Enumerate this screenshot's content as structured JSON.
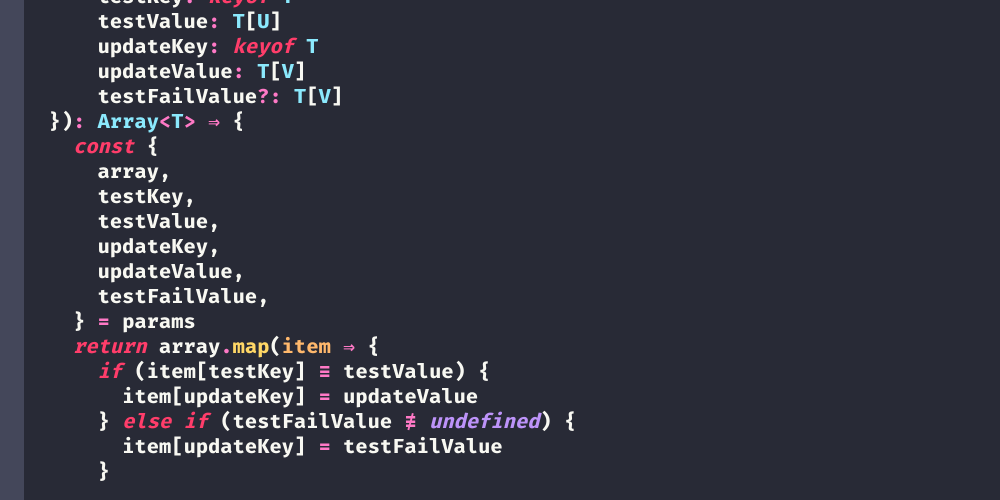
{
  "code": {
    "lines": [
      {
        "indent": 2,
        "tokens": [
          {
            "t": "testKey",
            "c": "ident"
          },
          {
            "t": ": ",
            "c": "op"
          },
          {
            "t": "keyof ",
            "c": "kw"
          },
          {
            "t": "T",
            "c": "type"
          }
        ]
      },
      {
        "indent": 2,
        "tokens": [
          {
            "t": "testValue",
            "c": "ident"
          },
          {
            "t": ": ",
            "c": "op"
          },
          {
            "t": "T",
            "c": "type"
          },
          {
            "t": "[",
            "c": "br"
          },
          {
            "t": "U",
            "c": "type"
          },
          {
            "t": "]",
            "c": "br"
          }
        ]
      },
      {
        "indent": 2,
        "tokens": [
          {
            "t": "updateKey",
            "c": "ident"
          },
          {
            "t": ": ",
            "c": "op"
          },
          {
            "t": "keyof ",
            "c": "kw"
          },
          {
            "t": "T",
            "c": "type"
          }
        ]
      },
      {
        "indent": 2,
        "tokens": [
          {
            "t": "updateValue",
            "c": "ident"
          },
          {
            "t": ": ",
            "c": "op"
          },
          {
            "t": "T",
            "c": "type"
          },
          {
            "t": "[",
            "c": "br"
          },
          {
            "t": "V",
            "c": "type"
          },
          {
            "t": "]",
            "c": "br"
          }
        ]
      },
      {
        "indent": 2,
        "tokens": [
          {
            "t": "testFailValue",
            "c": "ident"
          },
          {
            "t": "?: ",
            "c": "op"
          },
          {
            "t": "T",
            "c": "type"
          },
          {
            "t": "[",
            "c": "br"
          },
          {
            "t": "V",
            "c": "type"
          },
          {
            "t": "]",
            "c": "br"
          }
        ]
      },
      {
        "indent": 0,
        "tokens": [
          {
            "t": "}",
            "c": "br"
          },
          {
            "t": ")",
            "c": "br"
          },
          {
            "t": ": ",
            "c": "op"
          },
          {
            "t": "Array",
            "c": "type"
          },
          {
            "t": "<",
            "c": "op"
          },
          {
            "t": "T",
            "c": "type"
          },
          {
            "t": ">",
            "c": "op"
          },
          {
            "t": " ",
            "c": "fg"
          },
          {
            "t": "⇒",
            "c": "op"
          },
          {
            "t": " ",
            "c": "fg"
          },
          {
            "t": "{",
            "c": "br"
          }
        ]
      },
      {
        "indent": 1,
        "tokens": [
          {
            "t": "const ",
            "c": "kw"
          },
          {
            "t": "{",
            "c": "br"
          }
        ]
      },
      {
        "indent": 2,
        "tokens": [
          {
            "t": "array",
            "c": "ident"
          },
          {
            "t": ",",
            "c": "punc"
          }
        ]
      },
      {
        "indent": 2,
        "tokens": [
          {
            "t": "testKey",
            "c": "ident"
          },
          {
            "t": ",",
            "c": "punc"
          }
        ]
      },
      {
        "indent": 2,
        "tokens": [
          {
            "t": "testValue",
            "c": "ident"
          },
          {
            "t": ",",
            "c": "punc"
          }
        ]
      },
      {
        "indent": 2,
        "tokens": [
          {
            "t": "updateKey",
            "c": "ident"
          },
          {
            "t": ",",
            "c": "punc"
          }
        ]
      },
      {
        "indent": 2,
        "tokens": [
          {
            "t": "updateValue",
            "c": "ident"
          },
          {
            "t": ",",
            "c": "punc"
          }
        ]
      },
      {
        "indent": 2,
        "tokens": [
          {
            "t": "testFailValue",
            "c": "ident"
          },
          {
            "t": ",",
            "c": "punc"
          }
        ]
      },
      {
        "indent": 1,
        "tokens": [
          {
            "t": "} ",
            "c": "br"
          },
          {
            "t": "=",
            "c": "op"
          },
          {
            "t": " params",
            "c": "ident"
          }
        ]
      },
      {
        "indent": 1,
        "tokens": [
          {
            "t": "return ",
            "c": "kw"
          },
          {
            "t": "array",
            "c": "ident"
          },
          {
            "t": ".",
            "c": "op"
          },
          {
            "t": "map",
            "c": "fn"
          },
          {
            "t": "(",
            "c": "br"
          },
          {
            "t": "item ",
            "c": "param"
          },
          {
            "t": "⇒",
            "c": "op"
          },
          {
            "t": " ",
            "c": "fg"
          },
          {
            "t": "{",
            "c": "br"
          }
        ]
      },
      {
        "indent": 2,
        "tokens": [
          {
            "t": "if ",
            "c": "kw"
          },
          {
            "t": "(",
            "c": "br"
          },
          {
            "t": "item",
            "c": "ident"
          },
          {
            "t": "[",
            "c": "br"
          },
          {
            "t": "testKey",
            "c": "ident"
          },
          {
            "t": "]",
            "c": "br"
          },
          {
            "t": " ",
            "c": "fg"
          },
          {
            "t": "≡",
            "c": "op"
          },
          {
            "t": " ",
            "c": "fg"
          },
          {
            "t": "testValue",
            "c": "ident"
          },
          {
            "t": ")",
            "c": "br"
          },
          {
            "t": " ",
            "c": "fg"
          },
          {
            "t": "{",
            "c": "br"
          }
        ]
      },
      {
        "indent": 3,
        "tokens": [
          {
            "t": "item",
            "c": "ident"
          },
          {
            "t": "[",
            "c": "br"
          },
          {
            "t": "updateKey",
            "c": "ident"
          },
          {
            "t": "]",
            "c": "br"
          },
          {
            "t": " ",
            "c": "fg"
          },
          {
            "t": "=",
            "c": "op"
          },
          {
            "t": " ",
            "c": "fg"
          },
          {
            "t": "updateValue",
            "c": "ident"
          }
        ]
      },
      {
        "indent": 2,
        "tokens": [
          {
            "t": "} ",
            "c": "br"
          },
          {
            "t": "else if ",
            "c": "kw"
          },
          {
            "t": "(",
            "c": "br"
          },
          {
            "t": "testFailValue",
            "c": "ident"
          },
          {
            "t": " ",
            "c": "fg"
          },
          {
            "t": "≢",
            "c": "op"
          },
          {
            "t": " ",
            "c": "fg"
          },
          {
            "t": "undefined",
            "c": "undef"
          },
          {
            "t": ")",
            "c": "br"
          },
          {
            "t": " ",
            "c": "fg"
          },
          {
            "t": "{",
            "c": "br"
          }
        ]
      },
      {
        "indent": 3,
        "tokens": [
          {
            "t": "item",
            "c": "ident"
          },
          {
            "t": "[",
            "c": "br"
          },
          {
            "t": "updateKey",
            "c": "ident"
          },
          {
            "t": "]",
            "c": "br"
          },
          {
            "t": " ",
            "c": "fg"
          },
          {
            "t": "=",
            "c": "op"
          },
          {
            "t": " ",
            "c": "fg"
          },
          {
            "t": "testFailValue",
            "c": "ident"
          }
        ]
      },
      {
        "indent": 2,
        "tokens": [
          {
            "t": "}",
            "c": "br"
          }
        ]
      }
    ],
    "indent_unit": "  ",
    "base_pad": "  "
  }
}
